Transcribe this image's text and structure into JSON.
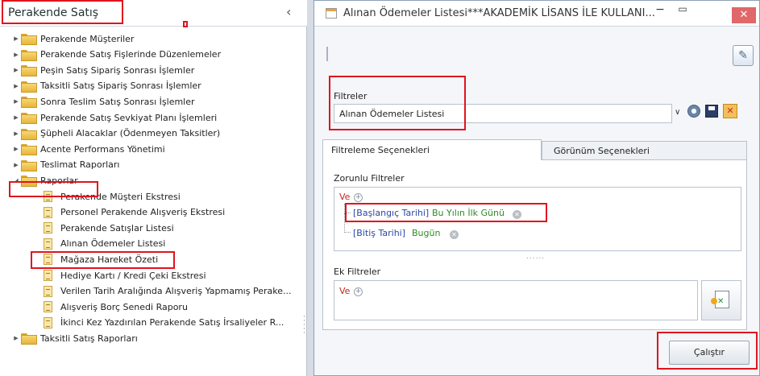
{
  "left_panel": {
    "title": "Perakende Satış",
    "collapse_glyph": "‹",
    "tree": [
      {
        "label": "Perakende Müşteriler",
        "type": "folder",
        "expanded": false
      },
      {
        "label": "Perakende Satış Fişlerinde Düzenlemeler",
        "type": "folder",
        "expanded": false
      },
      {
        "label": "Peşin Satış Sipariş Sonrası İşlemler",
        "type": "folder",
        "expanded": false
      },
      {
        "label": "Taksitli Satış Sipariş Sonrası İşlemler",
        "type": "folder",
        "expanded": false
      },
      {
        "label": "Sonra Teslim Satış Sonrası İşlemler",
        "type": "folder",
        "expanded": false
      },
      {
        "label": "Perakende Satış Sevkiyat Planı İşlemleri",
        "type": "folder",
        "expanded": false
      },
      {
        "label": "Şüpheli Alacaklar (Ödenmeyen Taksitler)",
        "type": "folder",
        "expanded": false
      },
      {
        "label": "Acente Performans Yönetimi",
        "type": "folder",
        "expanded": false
      },
      {
        "label": "Teslimat Raporları",
        "type": "folder",
        "expanded": false
      },
      {
        "label": "Raporlar",
        "type": "folder",
        "expanded": true
      },
      {
        "label": "Perakende Müşteri Ekstresi",
        "type": "report"
      },
      {
        "label": "Personel Perakende Alışveriş Ekstresi",
        "type": "report"
      },
      {
        "label": "Perakende Satışlar Listesi",
        "type": "report"
      },
      {
        "label": "Alınan Ödemeler Listesi",
        "type": "report",
        "selected": true
      },
      {
        "label": "Mağaza Hareket Özeti",
        "type": "report"
      },
      {
        "label": "Hediye Kartı / Kredi Çeki Ekstresi",
        "type": "report"
      },
      {
        "label": "Verilen Tarih Aralığında Alışveriş Yapmamış Perake...",
        "type": "report"
      },
      {
        "label": "Alışveriş Borç Senedi Raporu",
        "type": "report"
      },
      {
        "label": "İkinci Kez Yazdırılan Perakende Satış İrsaliyeler R...",
        "type": "report"
      },
      {
        "label": "Taksitli Satış Raporları",
        "type": "folder",
        "expanded": false
      }
    ]
  },
  "dialog": {
    "title": "Alınan Ödemeler Listesi***AKADEMİK LİSANS İLE KULLANI...",
    "min_glyph": "−",
    "max_glyph": "▭",
    "close_glyph": "✕",
    "filters": {
      "label": "Filtreler",
      "selected": "Alınan Ödemeler Listesi",
      "dropdown_glyph": "∨"
    },
    "tabs": [
      {
        "label": "Filtreleme Seçenekleri",
        "active": true
      },
      {
        "label": "Görünüm Seçenekleri",
        "active": false
      }
    ],
    "required_filters": {
      "label": "Zorunlu Filtreler",
      "operator": "Ve",
      "conditions": [
        {
          "field": "[Başlangıç Tarihi]",
          "value": "Bu Yılın İlk Günü"
        },
        {
          "field": "[Bitiş Tarihi]",
          "value": "Bugün"
        }
      ]
    },
    "grip": "......",
    "extra_filters": {
      "label": "Ek Filtreler",
      "operator": "Ve"
    },
    "run_button": "Çalıştır"
  },
  "colors": {
    "highlight_red": "#e0141e",
    "field_blue": "#2a47a8",
    "value_green": "#2c8a23",
    "operator_red": "#c0281e"
  },
  "icons": [
    "collapse-icon",
    "folder-icon",
    "report-icon",
    "settings-icon",
    "save-icon",
    "clear-filter-icon",
    "export-excel-icon",
    "tool-icon"
  ]
}
